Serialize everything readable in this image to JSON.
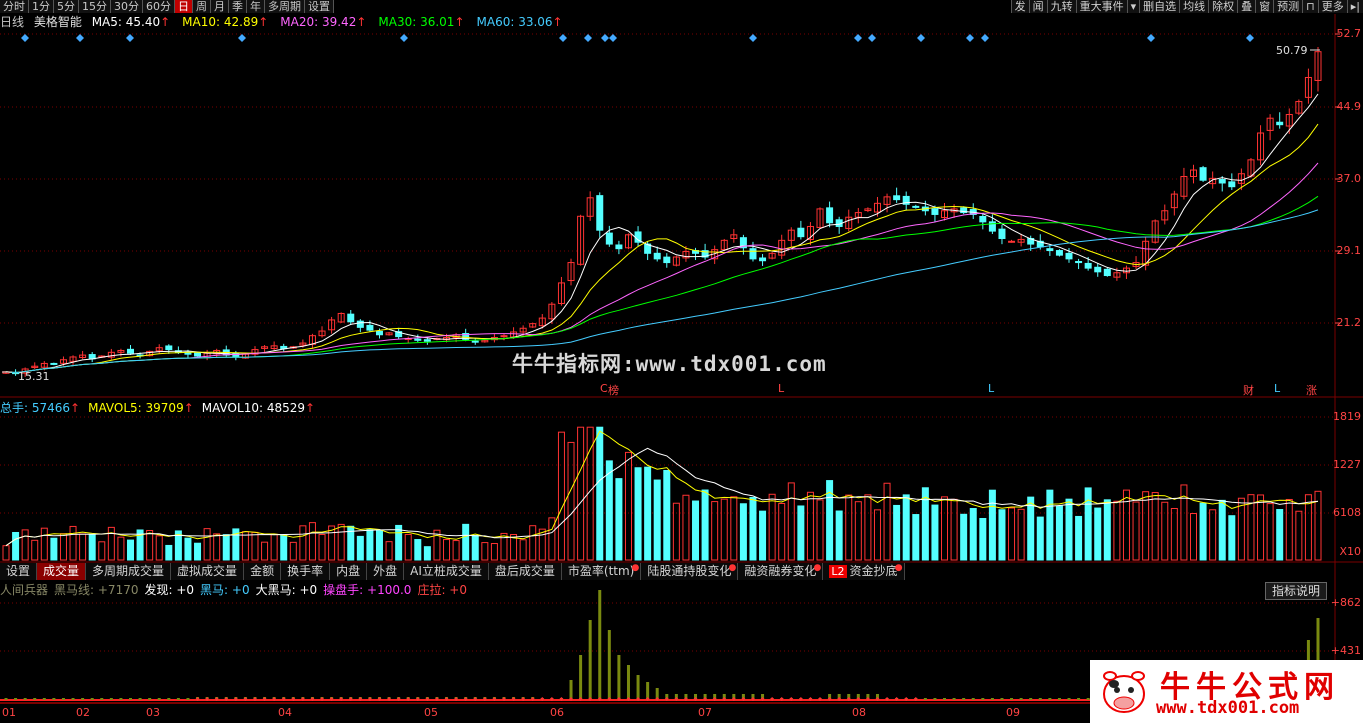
{
  "period_bar": [
    {
      "label": "分时",
      "active": false
    },
    {
      "label": "1分",
      "active": false
    },
    {
      "label": "5分",
      "active": false
    },
    {
      "label": "15分",
      "active": false
    },
    {
      "label": "30分",
      "active": false
    },
    {
      "label": "60分",
      "active": false
    },
    {
      "label": "日",
      "active": true
    },
    {
      "label": "周",
      "active": false
    },
    {
      "label": "月",
      "active": false
    },
    {
      "label": "季",
      "active": false
    },
    {
      "label": "年",
      "active": false
    },
    {
      "label": "多周期",
      "active": false
    },
    {
      "label": "设置",
      "active": false
    }
  ],
  "right_tools": [
    "发",
    "闻",
    "九转",
    "重大事件",
    "▾",
    "删自选",
    "均线",
    "除权",
    "叠",
    "窗",
    "预测",
    "⊓",
    "更多",
    "▸|"
  ],
  "kline_header": {
    "period": "日线",
    "stock_name": "美格智能",
    "ma": [
      {
        "label": "MA5: 45.40",
        "color": "#ffffff"
      },
      {
        "label": "MA10: 42.89",
        "color": "#ffff00"
      },
      {
        "label": "MA20: 39.42",
        "color": "#ff66ff"
      },
      {
        "label": "MA30: 36.01",
        "color": "#00ff00"
      },
      {
        "label": "MA60: 33.06",
        "color": "#44ccff"
      }
    ],
    "arrow": "↑"
  },
  "price_axis": [
    "52.7",
    "44.9",
    "37.0",
    "29.1",
    "21.2"
  ],
  "price_high_label": "50.79",
  "price_low_label": "15.31",
  "watermark": "牛牛指标网:www.tdx001.com",
  "event_marks": [
    {
      "label": "C",
      "color": "#ff4444"
    },
    {
      "label": "榜",
      "color": "#ff4444"
    },
    {
      "label": "L",
      "color": "#ff4444"
    },
    {
      "label": "L",
      "color": "#44ccff"
    },
    {
      "label": "财",
      "color": "#ff4444"
    },
    {
      "label": "L",
      "color": "#44ccff"
    },
    {
      "label": "涨",
      "color": "#ff4444"
    }
  ],
  "volume_header": [
    {
      "label": "总手: 57466",
      "color": "#44ccff"
    },
    {
      "label": "MAVOL5: 39709",
      "color": "#ffff00"
    },
    {
      "label": "MAVOL10: 48529",
      "color": "#ffffff"
    }
  ],
  "volume_axis": [
    "1819",
    "1227",
    "6108",
    "X10"
  ],
  "indicator_tabs": [
    {
      "label": "设置",
      "active": false,
      "dot": false
    },
    {
      "label": "成交量",
      "active": true,
      "dot": false
    },
    {
      "label": "多周期成交量",
      "active": false,
      "dot": false
    },
    {
      "label": "虚拟成交量",
      "active": false,
      "dot": false
    },
    {
      "label": "金额",
      "active": false,
      "dot": false
    },
    {
      "label": "换手率",
      "active": false,
      "dot": false
    },
    {
      "label": "内盘",
      "active": false,
      "dot": false
    },
    {
      "label": "外盘",
      "active": false,
      "dot": false
    },
    {
      "label": "AI立桩成交量",
      "active": false,
      "dot": false
    },
    {
      "label": "盘后成交量",
      "active": false,
      "dot": false
    },
    {
      "label": "市盈率(ttm)",
      "active": false,
      "dot": true
    },
    {
      "label": "陆股通持股变化",
      "active": false,
      "dot": true
    },
    {
      "label": "融资融券变化",
      "active": false,
      "dot": true
    },
    {
      "label": "资金抄底",
      "active": false,
      "dot": true,
      "l2": "L2"
    }
  ],
  "indicator_header": [
    {
      "label": "人间兵器",
      "color": "#888866"
    },
    {
      "label": "黑马线: +7170",
      "color": "#888866"
    },
    {
      "label": "发现: +0",
      "color": "#ffffff"
    },
    {
      "label": "黑马: +0",
      "color": "#44ccff"
    },
    {
      "label": "大黑马: +0",
      "color": "#ffffff"
    },
    {
      "label": "操盘手: +100.0",
      "color": "#ff44ff"
    },
    {
      "label": "庄拉: +0",
      "color": "#ff4444"
    }
  ],
  "indicator_help": "指标说明",
  "indicator_axis": [
    "+862",
    "+431"
  ],
  "date_axis": [
    "01",
    "02",
    "03",
    "04",
    "05",
    "06",
    "07",
    "08",
    "09"
  ],
  "logo": {
    "title": "牛牛公式网",
    "url": "www.tdx001.com"
  },
  "colors": {
    "up": "#ff3333",
    "down": "#54ffff",
    "grid": "#7a0000",
    "axis": "#ff4444"
  },
  "chart_data": {
    "type": "candlestick",
    "note_units": "price",
    "ylim": [
      15.31,
      52.7
    ],
    "series": [
      {
        "name": "MA5",
        "value": 45.4
      },
      {
        "name": "MA10",
        "value": 42.89
      },
      {
        "name": "MA20",
        "value": 39.42
      },
      {
        "name": "MA30",
        "value": 36.01
      },
      {
        "name": "MA60",
        "value": 33.06
      }
    ],
    "close": [
      16.2,
      16.0,
      16.5,
      16.8,
      17.1,
      17.0,
      17.5,
      17.8,
      18.0,
      17.6,
      17.9,
      18.3,
      18.5,
      18.2,
      18.0,
      18.4,
      18.8,
      18.6,
      18.3,
      18.1,
      17.9,
      18.2,
      18.5,
      18.0,
      17.8,
      18.1,
      18.6,
      18.9,
      19.0,
      18.7,
      18.9,
      19.3,
      20.1,
      20.6,
      21.8,
      22.5,
      21.6,
      21.0,
      20.7,
      20.2,
      20.4,
      20.0,
      19.8,
      19.6,
      19.5,
      19.8,
      19.9,
      20.2,
      19.7,
      19.5,
      19.6,
      19.9,
      20.1,
      20.5,
      20.9,
      21.4,
      22.0,
      23.5,
      25.8,
      28.0,
      33.0,
      35.0,
      31.5,
      30.0,
      29.5,
      31.0,
      30.2,
      29.0,
      28.4,
      28.0,
      28.6,
      29.2,
      29.0,
      28.6,
      29.4,
      30.4,
      31.0,
      29.6,
      28.4,
      28.2,
      29.0,
      30.4,
      31.5,
      30.8,
      31.9,
      33.8,
      32.3,
      31.9,
      32.9,
      33.4,
      33.8,
      34.4,
      35.1,
      34.8,
      34.3,
      34.0,
      33.6,
      33.2,
      33.6,
      33.8,
      33.4,
      33.2,
      32.4,
      31.4,
      30.6,
      30.3,
      30.5,
      30.0,
      29.7,
      29.3,
      28.8,
      28.4,
      28.0,
      27.4,
      27.0,
      26.6,
      26.9,
      27.4,
      28.0,
      30.3,
      32.5,
      33.6,
      35.4,
      37.3,
      38.0,
      36.9,
      37.1,
      36.6,
      36.2,
      37.6,
      39.1,
      42.0,
      43.6,
      42.9,
      44.0,
      45.4,
      48.0,
      50.79
    ]
  }
}
